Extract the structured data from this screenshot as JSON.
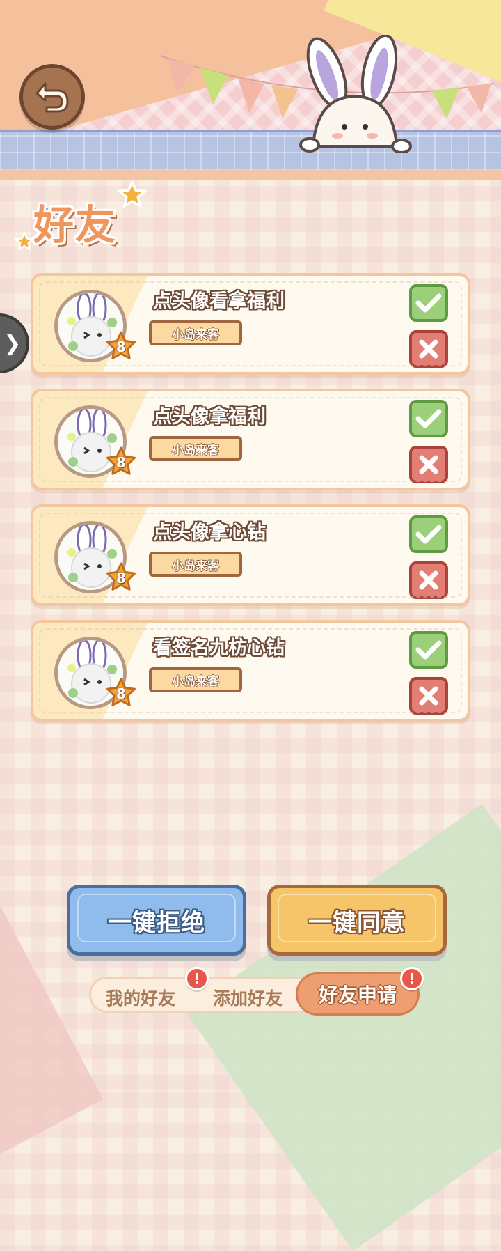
{
  "page": {
    "title": "好友"
  },
  "requests": [
    {
      "name": "点头像看拿福利",
      "tag": "小岛来客",
      "level": "8"
    },
    {
      "name": "点头像拿福利",
      "tag": "小岛来客",
      "level": "8"
    },
    {
      "name": "点头像拿心钻",
      "tag": "小岛来客",
      "level": "8"
    },
    {
      "name": "看签名九枋心钻",
      "tag": "小岛来客",
      "level": "8"
    }
  ],
  "actions": {
    "reject_all": "一键拒绝",
    "accept_all": "一键同意"
  },
  "tabs": {
    "my_friends": "我的好友",
    "add_friend": "添加好友",
    "friend_requests": "好友申请"
  },
  "badges": {
    "my_friends": "!",
    "friend_requests": "!"
  },
  "icons": {
    "back": "back-arrow-icon",
    "side_tab": "chevron-right-icon",
    "accept": "check-icon",
    "reject": "cross-icon",
    "level": "star-badge-icon"
  },
  "colors": {
    "accent_orange": "#f0955b",
    "accept_green": "#9ccf7a",
    "reject_red": "#e27e73",
    "reject_all_blue": "#8fbcec",
    "accept_all_yellow": "#f6c56a",
    "badge_red": "#e8564c"
  }
}
